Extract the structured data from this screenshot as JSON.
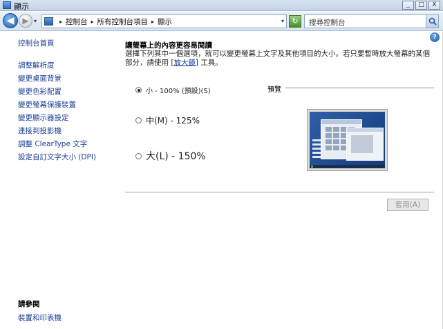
{
  "window": {
    "title": "顯示",
    "minimize": "_",
    "maximize": "□",
    "close": "X"
  },
  "nav": {
    "back_glyph": "◀",
    "forward_glyph": "▶",
    "recent_glyph": "▾",
    "breadcrumbs": [
      "控制台",
      "所有控制台項目",
      "顯示"
    ],
    "crumb_separator": "▸",
    "address_dropdown": "▾",
    "refresh_glyph": "↻",
    "search_placeholder": "搜尋控制台"
  },
  "help_glyph": "?",
  "sidebar": {
    "home": "控制台首頁",
    "links": [
      "調整解析度",
      "變更桌面背景",
      "變更色彩配置",
      "變更螢幕保護裝置",
      "變更顯示器設定",
      "連接到投影機",
      "調整 ClearType 文字",
      "設定自訂文字大小 (DPI)"
    ],
    "see_also_header": "請參閱",
    "see_also_links": [
      "裝置和印表機"
    ]
  },
  "main": {
    "heading": "讓螢幕上的內容更容易閱讀",
    "desc_part1": "選擇下列其中一個選項，就可以變更螢幕上文字及其他項目的大小。若只要暫時放大螢幕的某個部分，請使用 [",
    "desc_link": "放大鏡",
    "desc_part2": "] 工具。",
    "options": [
      {
        "label": "小 - 100% (預設)(S)",
        "selected": true
      },
      {
        "label": "中(M) - 125%",
        "selected": false
      },
      {
        "label": "大(L) - 150%",
        "selected": false
      }
    ],
    "preview_label": "預覽",
    "apply_button": "套用(A)"
  }
}
